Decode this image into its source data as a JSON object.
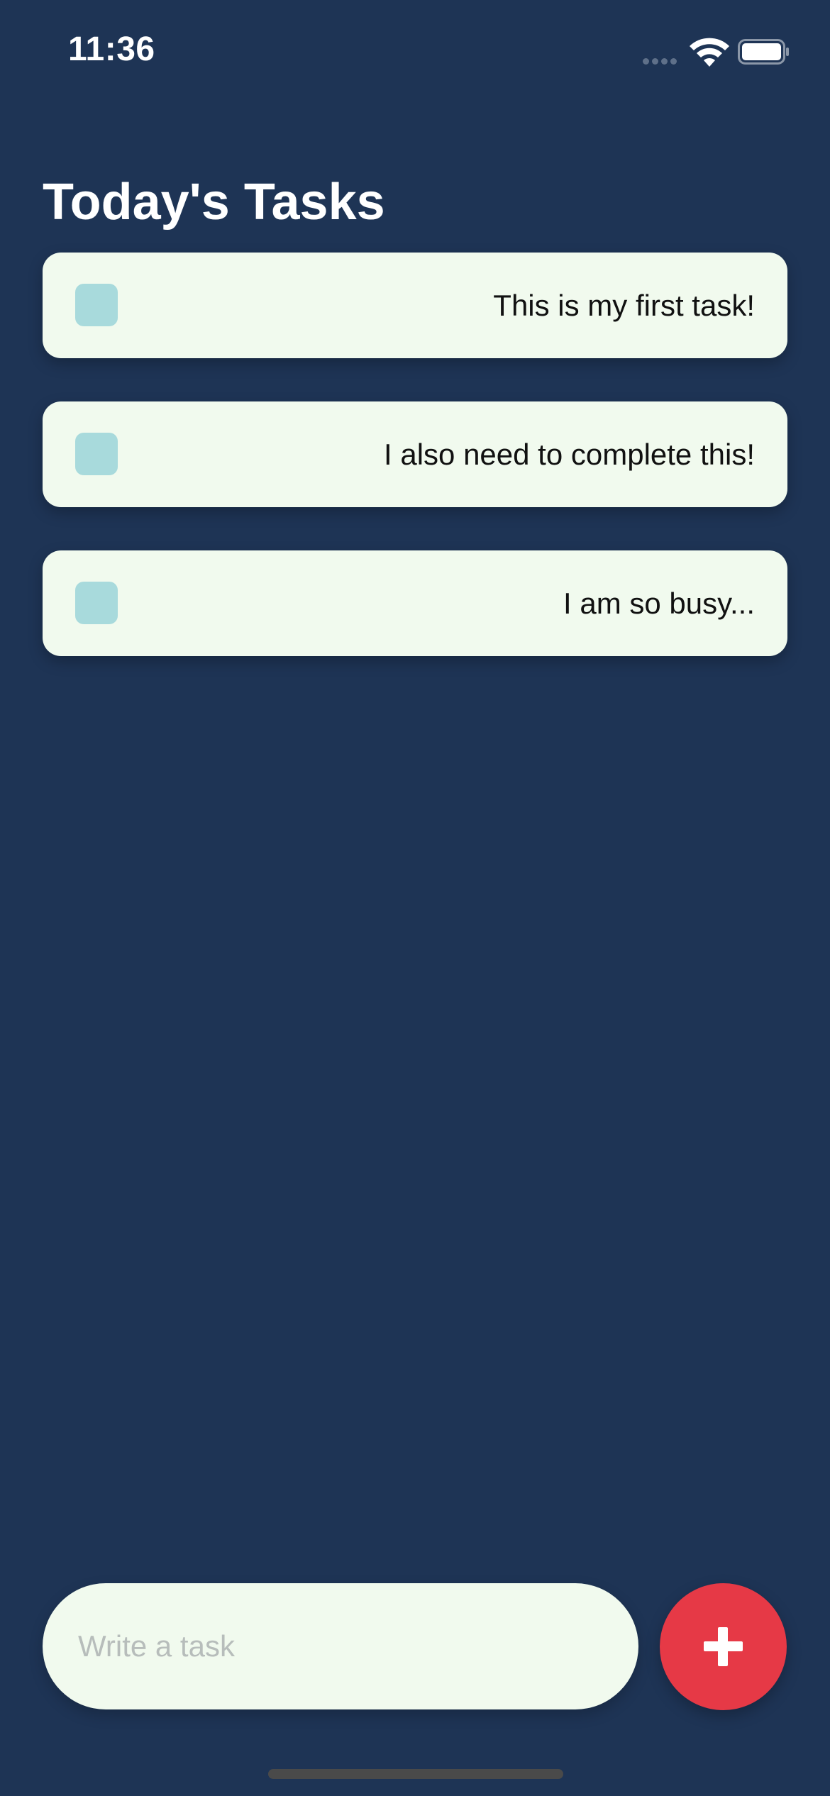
{
  "status_bar": {
    "time": "11:36"
  },
  "header": {
    "title": "Today's Tasks"
  },
  "tasks": [
    {
      "text": "This is my first task!",
      "completed": false
    },
    {
      "text": "I also need to complete this!",
      "completed": false
    },
    {
      "text": "I am so busy...",
      "completed": false
    }
  ],
  "composer": {
    "placeholder": "Write a task",
    "value": "",
    "add_icon": "plus-icon"
  },
  "colors": {
    "background": "#1e3455",
    "card": "#f1faee",
    "checkbox": "#a8dadc",
    "accent": "#e63946"
  }
}
